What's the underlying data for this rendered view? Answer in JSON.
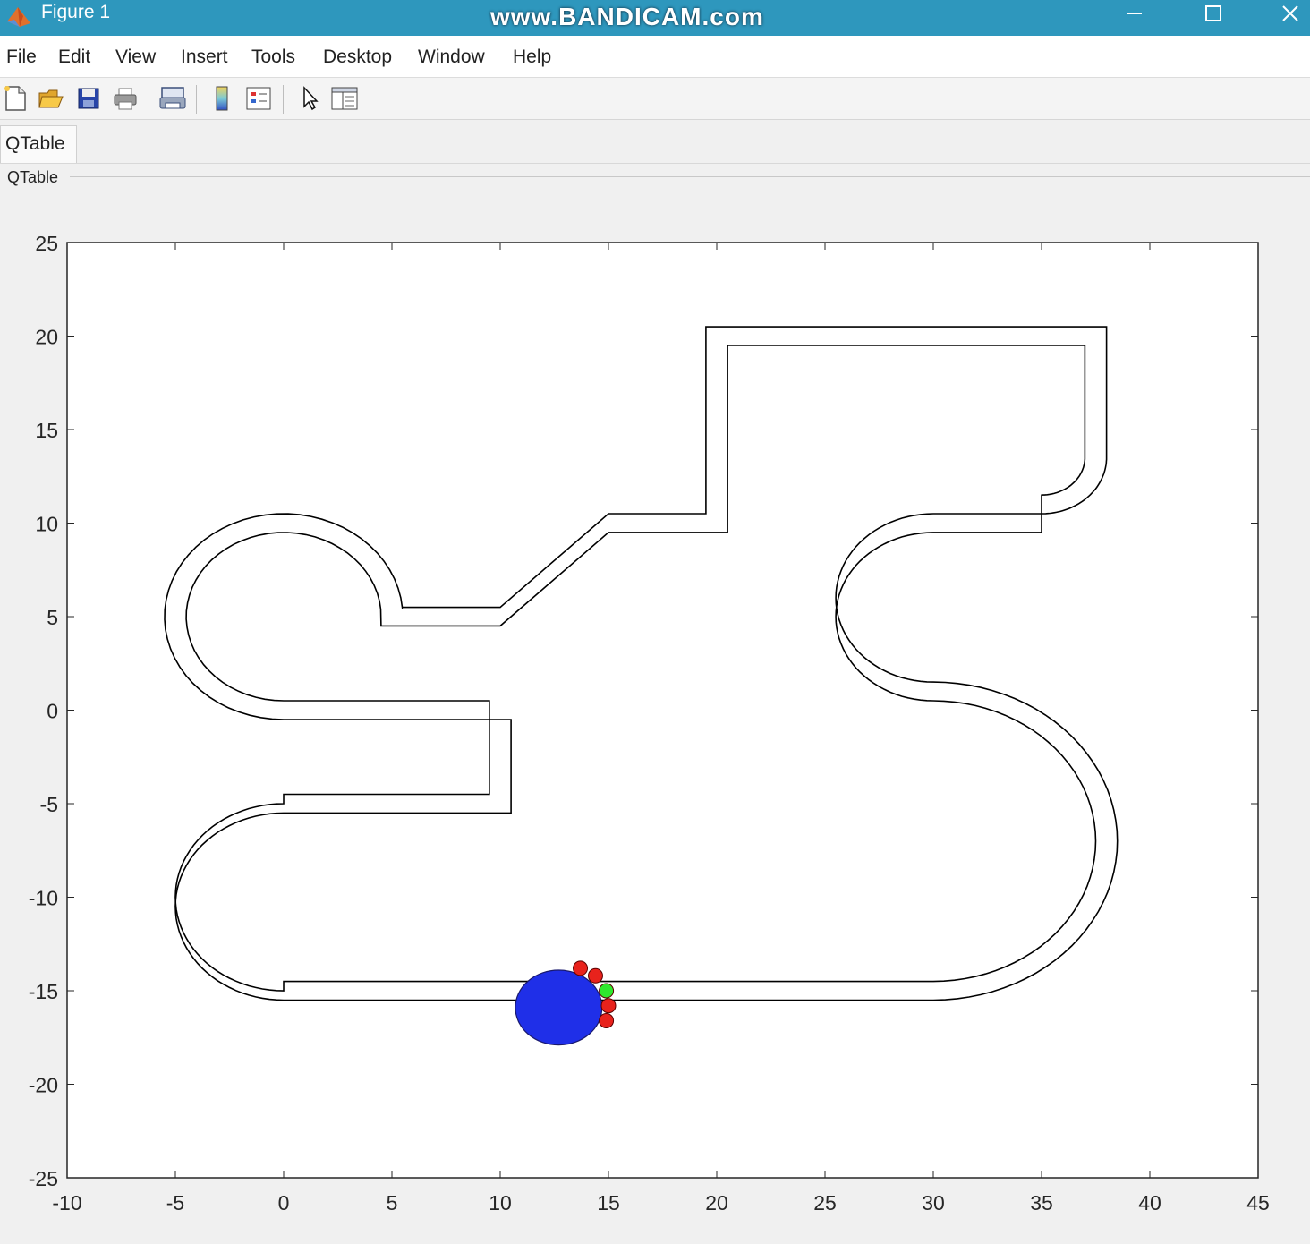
{
  "window": {
    "title": "Figure 1",
    "watermark": "www.BANDICAM.com",
    "controls": [
      "minimize-icon",
      "maximize-icon",
      "close-icon"
    ],
    "accent": "#2e97bd"
  },
  "menu": {
    "items": [
      "File",
      "Edit",
      "View",
      "Insert",
      "Tools",
      "Desktop",
      "Window",
      "Help"
    ]
  },
  "toolbar": {
    "icons": [
      "new-figure-icon",
      "open-file-icon",
      "save-icon",
      "print-icon",
      "link-plot-icon",
      "colorbar-icon",
      "legend-icon",
      "pointer-icon",
      "property-inspector-icon"
    ]
  },
  "tabs": {
    "active": "QTable"
  },
  "panel": {
    "title": "QTable"
  },
  "chart_data": {
    "type": "line",
    "title": "",
    "xlabel": "",
    "ylabel": "",
    "xlim": [
      -10,
      45
    ],
    "ylim": [
      -25,
      25
    ],
    "xticks": [
      -10,
      -5,
      0,
      5,
      10,
      15,
      20,
      25,
      30,
      35,
      40,
      45
    ],
    "yticks": [
      25,
      20,
      15,
      10,
      5,
      0,
      -5,
      -10,
      -15,
      -20,
      -25
    ],
    "grid": false,
    "track_color": "#000000",
    "track_outer": [
      [
        0,
        -15.5
      ],
      [
        30,
        -15.5
      ],
      {
        "arc": {
          "cx": 30,
          "cy": -7,
          "r": 8.5,
          "from": -90,
          "to": 90
        }
      },
      [
        30,
        1.5
      ],
      {
        "arc": {
          "cx": 30,
          "cy": 6,
          "r": 4.5,
          "from": 270,
          "to": 90,
          "ccw": true
        }
      },
      [
        35,
        10.5
      ],
      {
        "arc": {
          "cx": 35,
          "cy": 13.5,
          "r": 3,
          "from": -90,
          "to": 0
        }
      },
      [
        38,
        20.5
      ],
      [
        19.5,
        20.5
      ],
      [
        19.5,
        10.5
      ],
      [
        15,
        10.5
      ],
      [
        10,
        5.5
      ],
      [
        5.5,
        5.5
      ],
      {
        "arc": {
          "cx": 0,
          "cy": 5,
          "r": 5.5,
          "from": 5,
          "to": 270
        }
      },
      [
        0,
        -0.5
      ],
      [
        10.5,
        -0.5
      ],
      [
        10.5,
        -5.5
      ],
      [
        0,
        -5.5
      ],
      {
        "arc": {
          "cx": 0,
          "cy": -10.5,
          "r": 5,
          "from": 90,
          "to": 270
        }
      }
    ],
    "track_inner": [
      [
        0,
        -14.5
      ],
      [
        30,
        -14.5
      ],
      {
        "arc": {
          "cx": 30,
          "cy": -7,
          "r": 7.5,
          "from": -90,
          "to": 90
        }
      },
      [
        30,
        0.5
      ],
      {
        "arc": {
          "cx": 30,
          "cy": 5,
          "r": 4.5,
          "from": 270,
          "to": 90,
          "ccw": true
        }
      },
      [
        35,
        9.5
      ],
      {
        "arc": {
          "cx": 35,
          "cy": 13.5,
          "r": 2,
          "from": -90,
          "to": 0
        }
      },
      [
        37,
        19.5
      ],
      [
        20.5,
        19.5
      ],
      [
        20.5,
        9.5
      ],
      [
        15,
        9.5
      ],
      [
        10,
        4.5
      ],
      [
        4.5,
        4.5
      ],
      {
        "arc": {
          "cx": 0,
          "cy": 5,
          "r": 4.5,
          "from": 5,
          "to": 270
        }
      },
      [
        0,
        0.5
      ],
      [
        9.5,
        0.5
      ],
      [
        9.5,
        -4.5
      ],
      [
        0,
        -4.5
      ],
      {
        "arc": {
          "cx": 0,
          "cy": -10,
          "r": 5,
          "from": 90,
          "to": 270
        }
      }
    ],
    "robot": {
      "body": {
        "x": 12.7,
        "y": -15.9,
        "rx": 2.0,
        "ry": 2.0,
        "color": "#1f2fe8"
      },
      "sensors": [
        {
          "x": 13.7,
          "y": -13.8,
          "color": "#e8221c"
        },
        {
          "x": 14.4,
          "y": -14.2,
          "color": "#e8221c"
        },
        {
          "x": 14.9,
          "y": -15.0,
          "color": "#2ee82e"
        },
        {
          "x": 15.0,
          "y": -15.8,
          "color": "#e8221c"
        },
        {
          "x": 14.9,
          "y": -16.6,
          "color": "#e8221c"
        }
      ]
    }
  }
}
